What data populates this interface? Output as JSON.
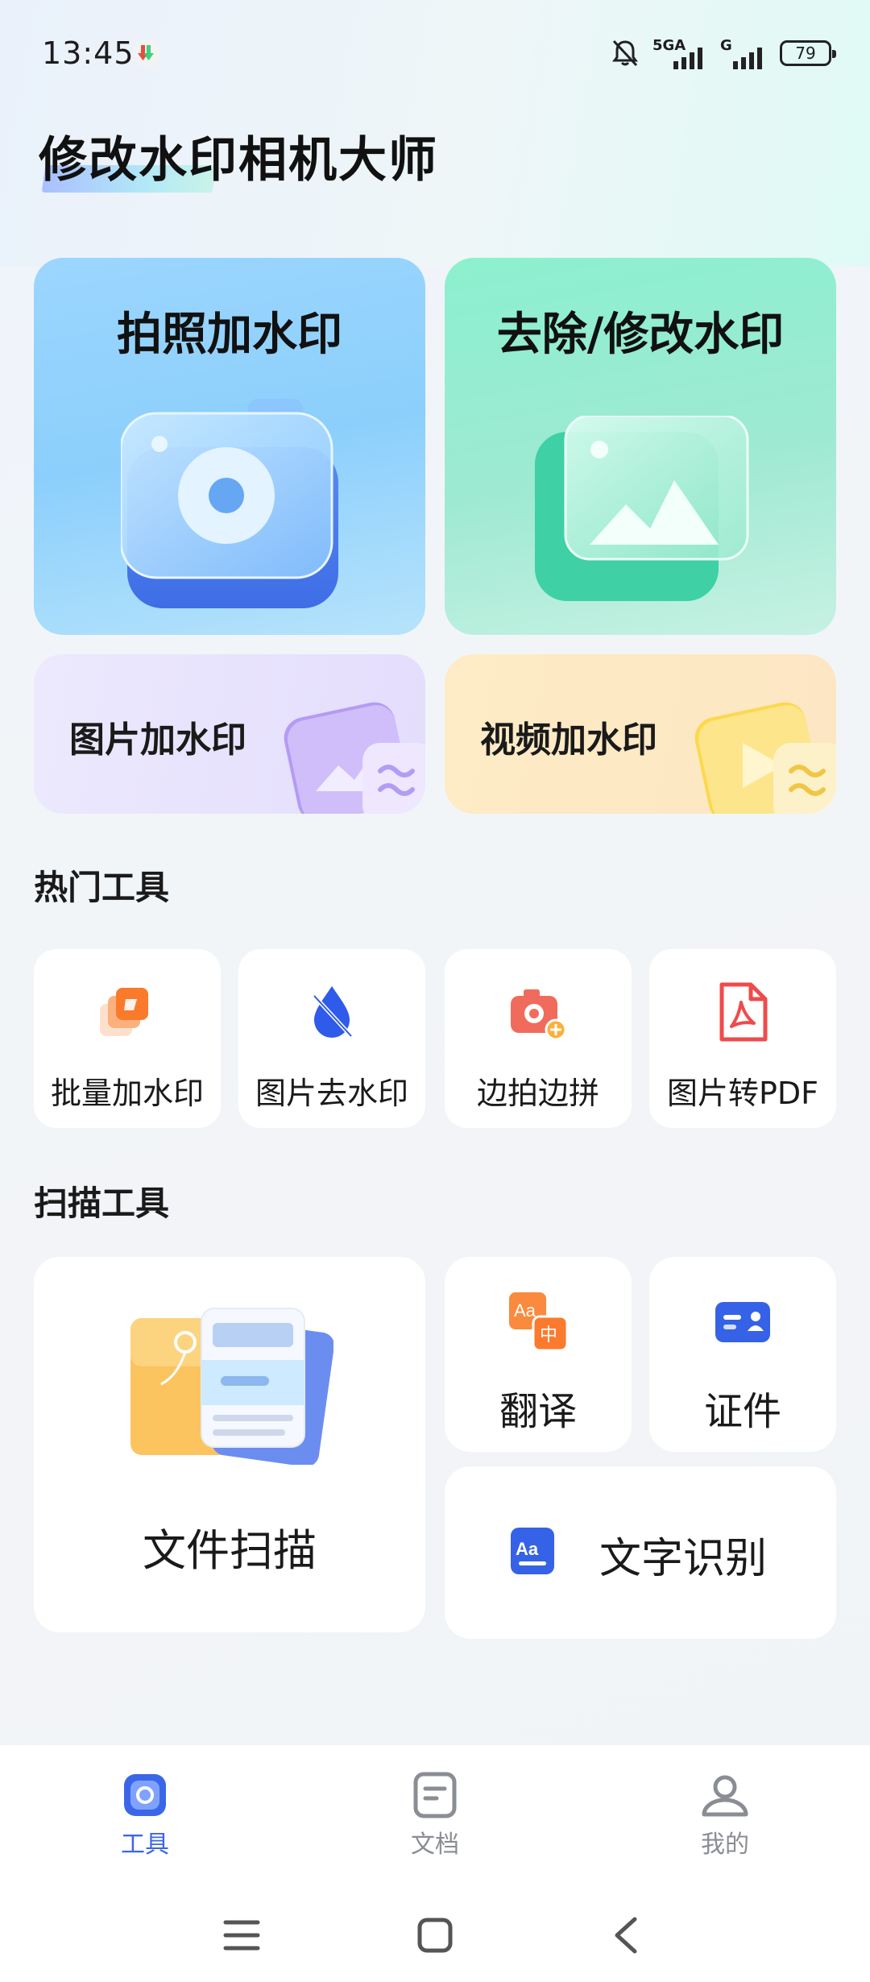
{
  "status_bar": {
    "time": "13:45",
    "network_1": "5GA",
    "network_2": "G",
    "battery": "79"
  },
  "app_title": "修改水印相机大师",
  "feature_cards": {
    "add_watermark_photo": "拍照加水印",
    "remove_watermark": "去除/修改水印",
    "image_watermark": "图片加水印",
    "video_watermark": "视频加水印"
  },
  "hot_tools": {
    "title": "热门工具",
    "items": [
      {
        "label": "批量加水印",
        "icon": "batch-watermark-icon"
      },
      {
        "label": "图片去水印",
        "icon": "drop-remove-icon"
      },
      {
        "label": "边拍边拼",
        "icon": "camera-plus-icon"
      },
      {
        "label": "图片转PDF",
        "icon": "pdf-icon"
      }
    ]
  },
  "scan_tools": {
    "title": "扫描工具",
    "file_scan": "文件扫描",
    "translate": "翻译",
    "id_card": "证件",
    "ocr": "文字识别"
  },
  "bottom_nav": {
    "items": [
      {
        "label": "工具",
        "icon": "tools-icon",
        "active": true
      },
      {
        "label": "文档",
        "icon": "document-icon",
        "active": false
      },
      {
        "label": "我的",
        "icon": "profile-icon",
        "active": false
      }
    ]
  },
  "colors": {
    "accent": "#3b66e8",
    "inactive": "#8a8d93"
  }
}
